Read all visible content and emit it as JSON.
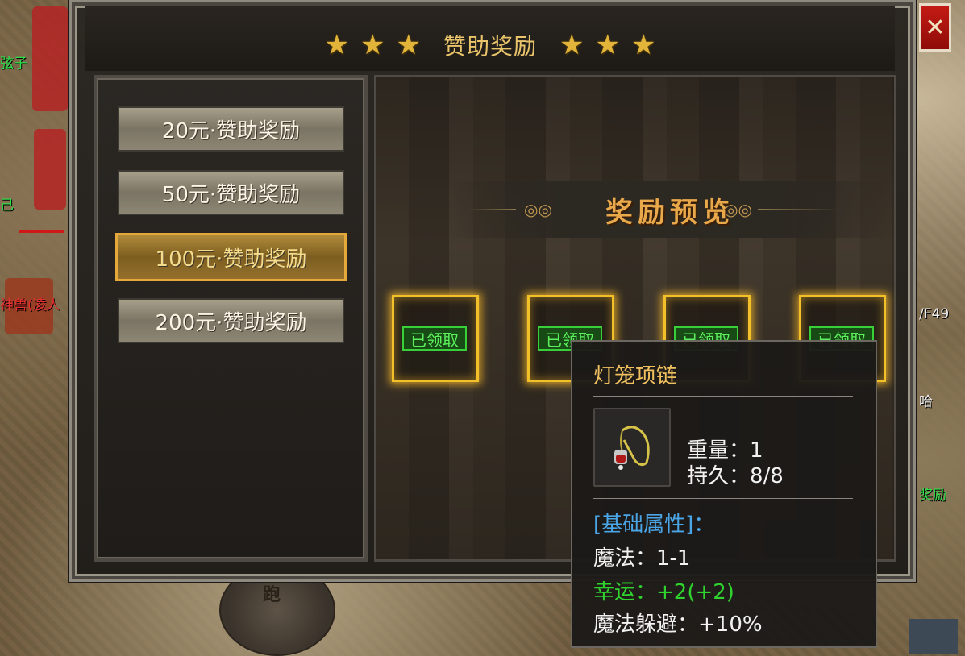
{
  "dialog": {
    "title": "赞助奖励",
    "stars_left": [
      "★",
      "★",
      "★"
    ],
    "stars_right": [
      "★",
      "★",
      "★"
    ],
    "close_label": "✕"
  },
  "tiers": [
    {
      "label": "20元·赞助奖励",
      "selected": false
    },
    {
      "label": "50元·赞助奖励",
      "selected": false
    },
    {
      "label": "100元·赞助奖励",
      "selected": true
    },
    {
      "label": "200元·赞助奖励",
      "selected": false
    }
  ],
  "preview": {
    "title": "奖励预览",
    "slots": [
      {
        "status": "已领取"
      },
      {
        "status": "已领取"
      },
      {
        "status": "已领取"
      },
      {
        "status": "已领取"
      }
    ]
  },
  "tooltip": {
    "item_name": "灯笼项链",
    "weight": "重量：1",
    "durability": "持久：8/8",
    "section_header": "[基础属性]：",
    "magic": "魔法：1-1",
    "luck": "幸运：+2(+2)",
    "magic_evasion": "魔法躲避：+10%"
  },
  "world": {
    "label_top_left": "弦子",
    "label_red": "神兽(凌人",
    "label_left_mid": "己",
    "label_right_top": "/F49",
    "label_right_mid": "哈",
    "label_right_low": "奖励",
    "run_button": "跑"
  },
  "colors": {
    "gold_border": "#f2c12a",
    "claimed_green": "#38d038",
    "close_red": "#c41b14"
  }
}
